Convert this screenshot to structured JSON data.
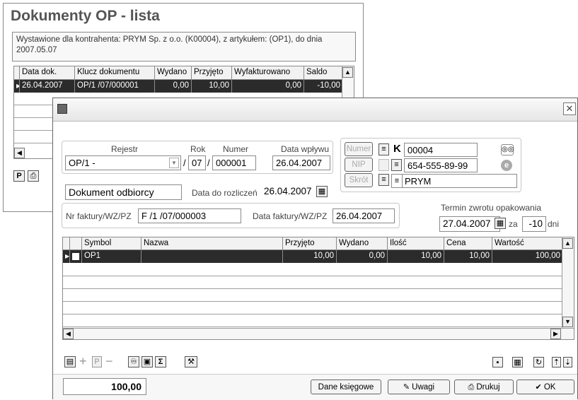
{
  "list_window": {
    "title": "Dokumenty OP - lista",
    "info": "Wystawione dla kontrahenta: PRYM Sp. z o.o. (K00004), z artykułem: (OP1), do dnia 2007.05.07",
    "columns": [
      "Data dok.",
      "Klucz dokumentu",
      "Wydano",
      "Przyjęto",
      "Wyfakturowano",
      "Saldo"
    ],
    "rows": [
      [
        "26.04.2007",
        "OP/1 /07/000001",
        "0,00",
        "10,00",
        "0,00",
        "-10,00"
      ]
    ],
    "btn_p": "P"
  },
  "doc_window": {
    "rejestr_label": "Rejestr",
    "rejestr_value": "OP/1  -",
    "rok_label": "Rok",
    "rok_value": "07",
    "numer_label": "Numer",
    "numer_value": "000001",
    "data_wplywu_label": "Data wpływu",
    "data_wplywu_value": "26.04.2007",
    "slash": "/",
    "doc_type": "Dokument odbiorcy",
    "data_rozliczen_label": "Data do rozliczeń",
    "data_rozliczen_value": "26.04.2007",
    "kontrahent": {
      "numer_btn": "Numer",
      "nip_btn": "NIP",
      "skrot_btn": "Skrót",
      "k_label": "K",
      "numer_value": "00004",
      "nip_value": "654-555-89-99",
      "skrot_value": "PRYM"
    },
    "nr_faktury_label": "Nr faktury/WZ/PZ",
    "nr_faktury_value": "F /1  /07/000003",
    "data_faktury_label": "Data faktury/WZ/PZ",
    "data_faktury_value": "26.04.2007",
    "termin_label": "Termin zwrotu  opakowania",
    "termin_value": "27.04.2007",
    "za_label": "za",
    "dni_value": "-10",
    "dni_label": "dni",
    "columns": [
      "Symbol",
      "Nazwa",
      "Przyjęto",
      "Wydano",
      "Ilość",
      "Cena",
      "Wartość"
    ],
    "rows": [
      [
        "OP1",
        "",
        "10,00",
        "0,00",
        "10,00",
        "10,00",
        "100,00"
      ]
    ],
    "tb_p": "P",
    "tb_sigma": "Σ",
    "total": "100,00",
    "btn_dane": "Dane księgowe",
    "btn_uwagi": "Uwagi",
    "btn_drukuj": "Drukuj",
    "btn_ok": "OK"
  }
}
